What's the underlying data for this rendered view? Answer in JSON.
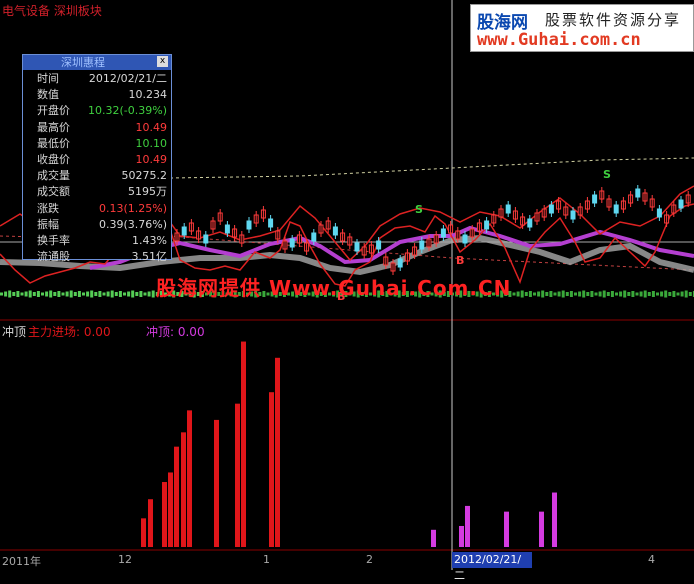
{
  "header": {
    "title": "电气设备 深圳板块"
  },
  "logo": {
    "name": "股海网",
    "tagline": "股票软件资源分享",
    "url": "www.Guhai.com.cn"
  },
  "info_panel": {
    "title": "深圳惠程",
    "close_glyph": "x",
    "rows": [
      {
        "label": "时间",
        "value": "2012/02/21/二",
        "color": "#d8d8d8"
      },
      {
        "label": "数值",
        "value": "10.234",
        "color": "#d8d8d8"
      },
      {
        "label": "开盘价",
        "value": "10.32(-0.39%)",
        "color": "#3fcf3f"
      },
      {
        "label": "最高价",
        "value": "10.49",
        "color": "#ff3b3b"
      },
      {
        "label": "最低价",
        "value": "10.10",
        "color": "#3fcf3f"
      },
      {
        "label": "收盘价",
        "value": "10.49",
        "color": "#ff3b3b"
      },
      {
        "label": "成交量",
        "value": "50275.2",
        "color": "#d8d8d8"
      },
      {
        "label": "成交额",
        "value": "5195万",
        "color": "#d8d8d8"
      },
      {
        "label": "涨跌",
        "value": "0.13(1.25%)",
        "color": "#ff3b3b"
      },
      {
        "label": "振幅",
        "value": "0.39(3.76%)",
        "color": "#d8d8d8"
      },
      {
        "label": "换手率",
        "value": "1.43%",
        "color": "#d8d8d8"
      },
      {
        "label": "流通股",
        "value": "3.51亿",
        "color": "#d8d8d8"
      }
    ]
  },
  "markers": {
    "sell": "S",
    "buy": "B"
  },
  "watermark": "股海网提供 Www.Guhai.Com.CN",
  "indicator": {
    "name": "冲顶",
    "line1_label": "主力进场: 0.00",
    "line2_label": "冲顶: 0.00",
    "colors": {
      "red": "#e0161a",
      "magenta": "#d43be0"
    }
  },
  "axis": {
    "labels": [
      "2011年",
      "12",
      "1",
      "2",
      "4"
    ],
    "selected_date": "2012/02/21/二"
  },
  "chart_data": {
    "type": "bar",
    "series": [
      {
        "name": "主力进场",
        "values": [
          0,
          0,
          0,
          0,
          0,
          0,
          0,
          0,
          0,
          0,
          0,
          0,
          0,
          0,
          0,
          0,
          0,
          0,
          0,
          0,
          0,
          0,
          0,
          0,
          0,
          0,
          0,
          0,
          0,
          0,
          0,
          0,
          0,
          0,
          0,
          0,
          0,
          0,
          0,
          0,
          0,
          0,
          0,
          0,
          0,
          0,
          0,
          0,
          0,
          0,
          0,
          0,
          0,
          0,
          0,
          0,
          0,
          0,
          0,
          0,
          0,
          0,
          0,
          0,
          0,
          0,
          0,
          0,
          0,
          0,
          0,
          0,
          0,
          0,
          0,
          0,
          0,
          0,
          0,
          0,
          0,
          0,
          0,
          0,
          0,
          0,
          0,
          0,
          0,
          0,
          0,
          0,
          0,
          0,
          0,
          0,
          0,
          0,
          0,
          0,
          0,
          0,
          0,
          0,
          0,
          0,
          0,
          0,
          0,
          0,
          0,
          0,
          0,
          0,
          0,
          0,
          0,
          0,
          0,
          0,
          0,
          0,
          0,
          0,
          0,
          0,
          0,
          0,
          0,
          0,
          0,
          0,
          0,
          0,
          0,
          0,
          0,
          0,
          0,
          0,
          0,
          0,
          0,
          0,
          0,
          0,
          0,
          0,
          0,
          0,
          0,
          0,
          0,
          0,
          0,
          0,
          0,
          0,
          0,
          0,
          0,
          0,
          0,
          0,
          0,
          0,
          0,
          0,
          0,
          0,
          0,
          0,
          0,
          0,
          0,
          0,
          0,
          0,
          0,
          0,
          0,
          0,
          0,
          0,
          0,
          0,
          0,
          0,
          0,
          0,
          0,
          0,
          0,
          0,
          0,
          0,
          0,
          0,
          0,
          0,
          0,
          0,
          0,
          0,
          0,
          0,
          0,
          0,
          0,
          0,
          0,
          0,
          0,
          0,
          0,
          0,
          0,
          0,
          0,
          0,
          0,
          0,
          0,
          0,
          0,
          0,
          0,
          0,
          0,
          0,
          0,
          0,
          0,
          0,
          0,
          0,
          0,
          0,
          0,
          0,
          0,
          0,
          0,
          0,
          0,
          0,
          0,
          0,
          0,
          0,
          0,
          0,
          0,
          0,
          0,
          0,
          0,
          0,
          0,
          0,
          0,
          0,
          0,
          0,
          0,
          0,
          0,
          0,
          0,
          0,
          0,
          0,
          0,
          0,
          0,
          0,
          0,
          0,
          0,
          0,
          0,
          0,
          0,
          0,
          0,
          0,
          0,
          0,
          0,
          0,
          0,
          0,
          0,
          0,
          0,
          0,
          0,
          0,
          0,
          0,
          0,
          0,
          0,
          0,
          0,
          0,
          0,
          0,
          0,
          0,
          0,
          0,
          0,
          0,
          0,
          0,
          0,
          0,
          0,
          0,
          0,
          0
        ]
      }
    ],
    "red_bars": [
      {
        "x": 141,
        "v": 30
      },
      {
        "x": 148,
        "v": 50
      },
      {
        "x": 162,
        "v": 68
      },
      {
        "x": 168,
        "v": 78
      },
      {
        "x": 174,
        "v": 105
      },
      {
        "x": 181,
        "v": 120
      },
      {
        "x": 187,
        "v": 143
      },
      {
        "x": 214,
        "v": 133
      },
      {
        "x": 235,
        "v": 150
      },
      {
        "x": 241,
        "v": 215
      },
      {
        "x": 269,
        "v": 162
      },
      {
        "x": 275,
        "v": 198
      }
    ],
    "magenta_bars": [
      {
        "x": 431,
        "v": 18
      },
      {
        "x": 459,
        "v": 22
      },
      {
        "x": 465,
        "v": 43
      },
      {
        "x": 504,
        "v": 37
      },
      {
        "x": 539,
        "v": 37
      },
      {
        "x": 552,
        "v": 57
      }
    ],
    "ylim": [
      0,
      225
    ]
  }
}
